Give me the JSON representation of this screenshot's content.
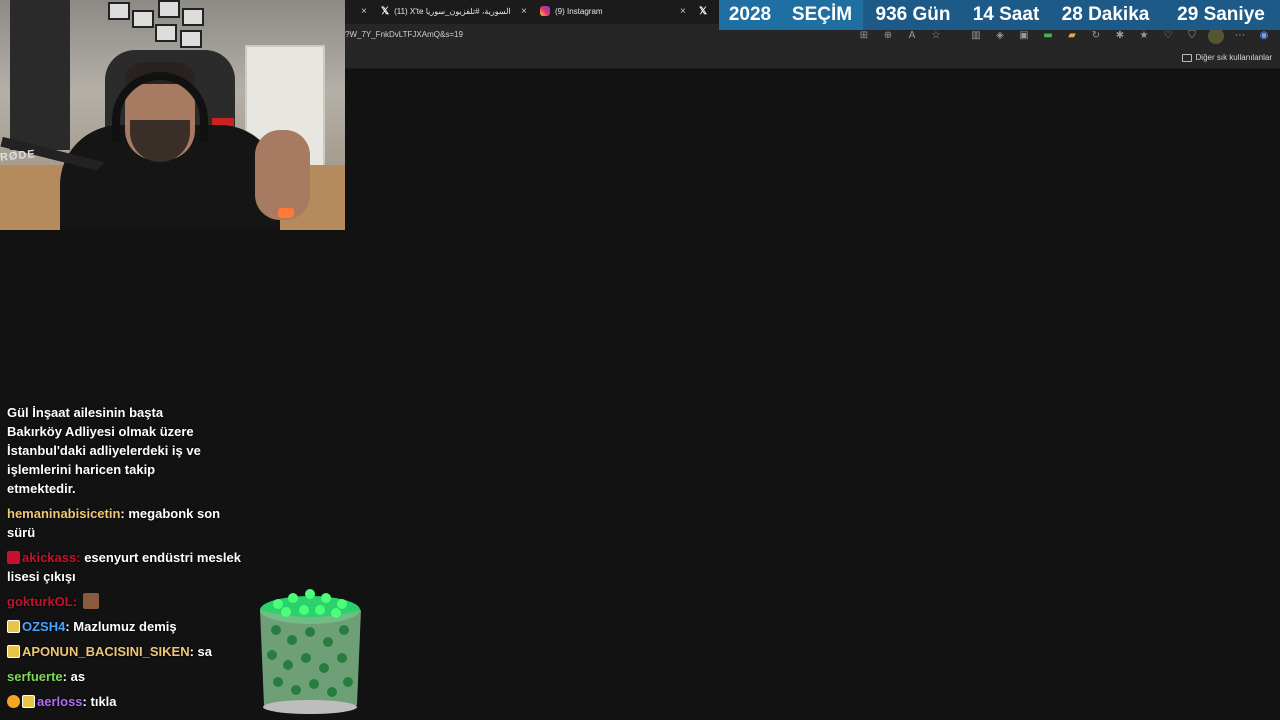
{
  "browser": {
    "tabs": [
      {
        "label": "(11) X'te السورية، #تلفزيون_سوريا",
        "icon": "x-icon",
        "close": "×"
      },
      {
        "label": "(9) Instagram",
        "icon": "instagram-icon",
        "close": "×"
      },
      {
        "label": "",
        "icon": "x-icon",
        "close": "×"
      }
    ],
    "leading_close": "×",
    "url": "?W_7Y_FnkDvLTFJXAmQ&s=19",
    "bookmarks_other": "Diğer sık kullanılanlar"
  },
  "countdown": {
    "items": [
      {
        "text": "2028",
        "color": "#1f6fa3"
      },
      {
        "text": "SEÇİM",
        "color": "#1f6fa3"
      },
      {
        "text": "936 Gün",
        "color": "#1e5a87"
      },
      {
        "text": "14 Saat",
        "color": "#1e5a87"
      },
      {
        "text": "28 Dakika",
        "color": "#1e5a87"
      },
      {
        "text": "29 Saniye",
        "color": "#1e5a87"
      }
    ]
  },
  "webcam": {
    "mic_brand": "RØDE"
  },
  "chat": {
    "announcement": [
      "Gül İnşaat ailesinin başta",
      "Bakırköy Adliyesi olmak üzere",
      "İstanbul'daki adliyelerdeki iş ve",
      "işlemlerini haricen takip",
      "etmektedir."
    ],
    "messages": [
      {
        "user": "hemaninabisicetin",
        "user_color": "#f0c674",
        "text": "megabonk son sürü"
      },
      {
        "user": "akickass",
        "user_color": "#c8102e",
        "text": "esenyurt endüstri meslek lisesi çıkışı"
      },
      {
        "user": "gokturkOL",
        "user_color": "#c8102e",
        "text": ""
      },
      {
        "user": "OZSH4",
        "user_color": "#4aa3ff",
        "text": "Mazlumuz demiş"
      },
      {
        "user": "APONUN_BACISINI_SIKEN",
        "user_color": "#f0c674",
        "text": "sa"
      },
      {
        "user": "serfuerte",
        "user_color": "#7ed957",
        "text": "as"
      },
      {
        "user": "aerloss",
        "user_color": "#b06cf0",
        "text": "tıkla"
      }
    ]
  }
}
